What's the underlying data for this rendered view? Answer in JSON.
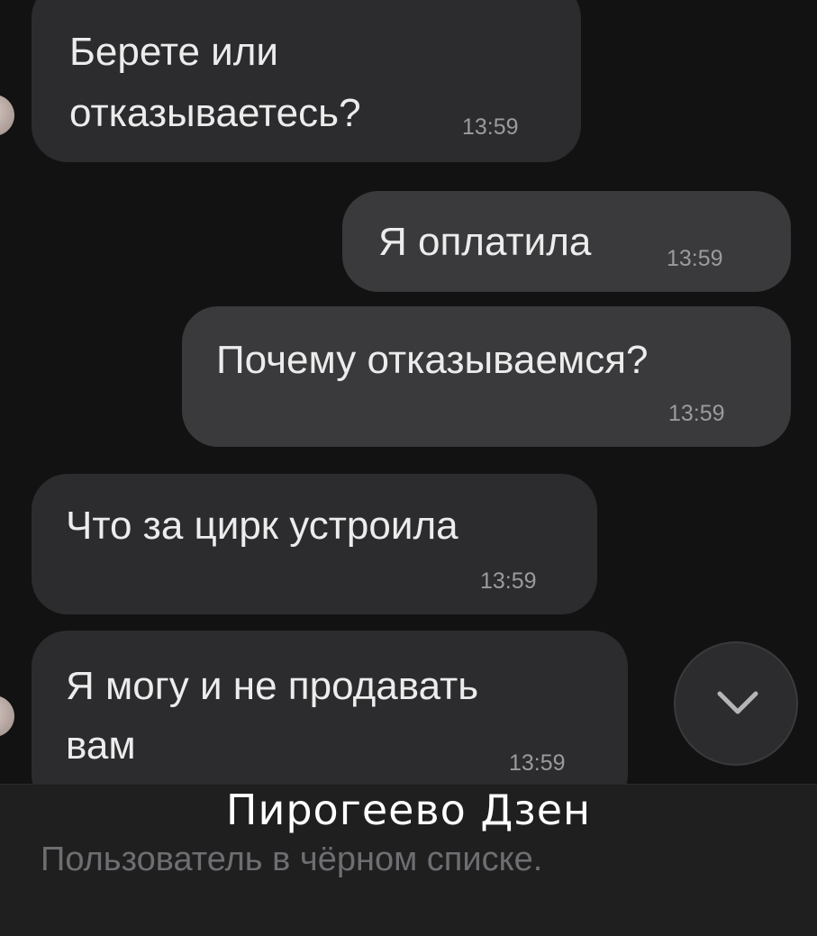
{
  "messages": [
    {
      "id": "m1",
      "direction": "incoming",
      "lines": [
        "Берете или",
        "отказываетесь?"
      ],
      "time": "13:59"
    },
    {
      "id": "m2",
      "direction": "outgoing",
      "lines": [
        "Я оплатила"
      ],
      "time": "13:59"
    },
    {
      "id": "m3",
      "direction": "outgoing",
      "lines": [
        "Почему отказываемся?"
      ],
      "time": "13:59"
    },
    {
      "id": "m4",
      "direction": "incoming",
      "lines": [
        "Что за цирк устроила"
      ],
      "time": "13:59"
    },
    {
      "id": "m5",
      "direction": "incoming",
      "lines": [
        "Я могу и не продавать",
        "вам"
      ],
      "time": "13:59"
    }
  ],
  "scroll_button": {
    "icon": "chevron-down-icon"
  },
  "watermark": "Пирогеево Дзен",
  "footer": {
    "blocked_text": "Пользователь в чёрном списке."
  },
  "colors": {
    "background": "#121212",
    "incoming_bubble": "#2c2c2e",
    "outgoing_bubble": "#3a3a3c",
    "text": "#ececec",
    "time": "#9b9b9f"
  }
}
